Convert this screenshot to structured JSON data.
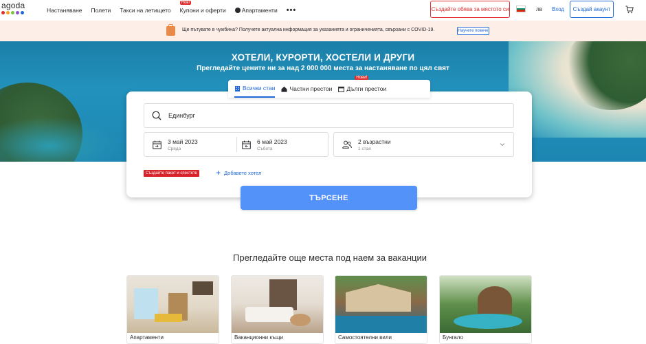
{
  "logo": {
    "text": "agoda",
    "dots": [
      "#e12d2d",
      "#f5a623",
      "#7ec242",
      "#8b55c9",
      "#2067da"
    ]
  },
  "nav": {
    "items": [
      {
        "label": "Настаняване",
        "badge": ""
      },
      {
        "label": "Полети",
        "badge": ""
      },
      {
        "label": "Такси на летището",
        "badge": ""
      },
      {
        "label": "Купони и оферти",
        "badge": "Нов!"
      },
      {
        "label": "Апартаменти",
        "badge": ""
      }
    ],
    "more": "•••",
    "list_property": "Създайте обява за мястото си",
    "language": "лв",
    "sign_in": "Вход",
    "create_account": "Създай акаунт"
  },
  "covid": {
    "text": "Ще пътувате в чужбина? Получете актуална информация за указанията и ограниченията, свързани с COVID-19.",
    "button": "Научете повече"
  },
  "hero": {
    "title": "ХОТЕЛИ, КУРОРТИ, ХОСТЕЛИ И ДРУГИ",
    "subtitle": "Прегледайте цените ни за над 2 000 000 места за настаняване по цял свят"
  },
  "tabs": [
    {
      "label": "Всички стаи",
      "badge": "",
      "active": true
    },
    {
      "label": "Частни престои",
      "badge": "",
      "active": false
    },
    {
      "label": "Дълги престои",
      "badge": "Нови!",
      "active": false
    }
  ],
  "search": {
    "destination": "Единбург",
    "checkin": {
      "date": "3 май 2023",
      "day": "Сряда"
    },
    "checkout": {
      "date": "6 май 2023",
      "day": "Събота"
    },
    "guests": {
      "main": "2 възрастни",
      "sub": "1 стая"
    },
    "package_tag": "Създайте пакет и спестете",
    "add_hotel": "Добавете хотел",
    "button": "ТЪРСЕНЕ"
  },
  "section": {
    "title": "Прегледайте още места под наем за ваканции",
    "cards": [
      {
        "label": "Апартаменти"
      },
      {
        "label": "Ваканционни къщи"
      },
      {
        "label": "Самостоятелни вили"
      },
      {
        "label": "Бунгало"
      }
    ]
  },
  "colors": {
    "accent": "#2067da",
    "search_button": "#5392f9",
    "alert": "#e12d2d",
    "covid_bg": "#fdeee8"
  }
}
